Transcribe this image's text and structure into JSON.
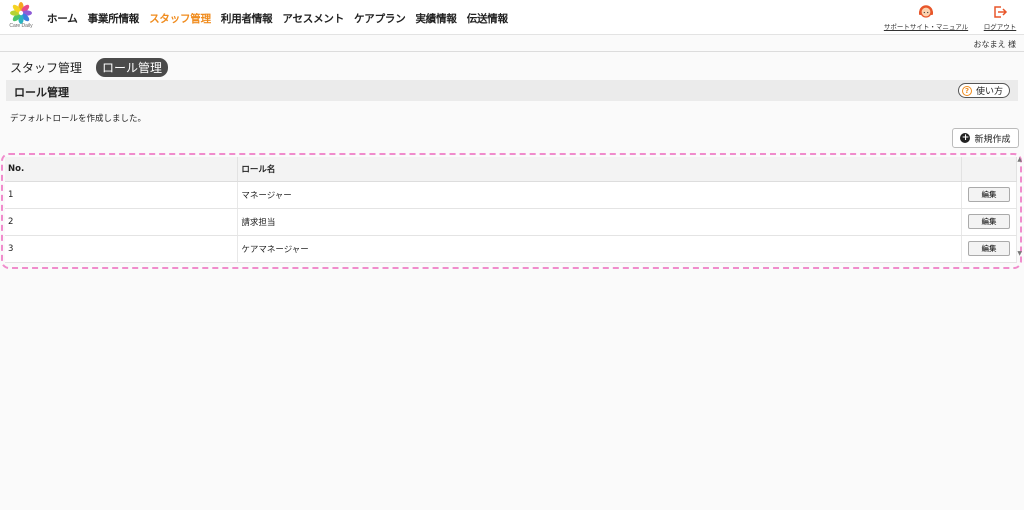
{
  "header": {
    "logo_text": "Care Daily",
    "nav": [
      {
        "label": "ホーム",
        "active": false
      },
      {
        "label": "事業所情報",
        "active": false
      },
      {
        "label": "スタッフ管理",
        "active": true
      },
      {
        "label": "利用者情報",
        "active": false
      },
      {
        "label": "アセスメント",
        "active": false
      },
      {
        "label": "ケアプラン",
        "active": false
      },
      {
        "label": "実績情報",
        "active": false
      },
      {
        "label": "伝送情報",
        "active": false
      }
    ],
    "support_label": "サポートサイト・マニュアル",
    "logout_label": "ログアウト",
    "username": "おなまえ 様",
    "accent_color": "#f08c1e"
  },
  "subnav": {
    "items": [
      {
        "label": "スタッフ管理",
        "active": false
      },
      {
        "label": "ロール管理",
        "active": true
      }
    ]
  },
  "section": {
    "title": "ロール管理",
    "help_label": "使い方",
    "help_icon": "?"
  },
  "message": "デフォルトロールを作成しました。",
  "new_button_label": "新規作成",
  "table": {
    "headers": [
      "No.",
      "ロール名",
      ""
    ],
    "rows": [
      {
        "no": "1",
        "name": "マネージャー",
        "action": "編集"
      },
      {
        "no": "2",
        "name": "請求担当",
        "action": "編集"
      },
      {
        "no": "3",
        "name": "ケアマネージャー",
        "action": "編集"
      }
    ]
  }
}
